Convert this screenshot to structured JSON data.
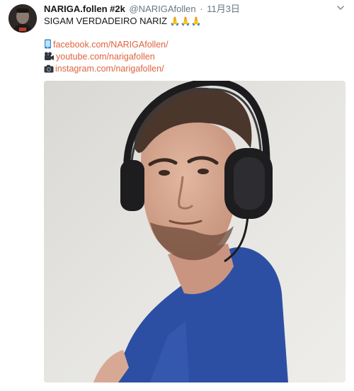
{
  "tweet": {
    "display_name": "NARIGA.follen #2k",
    "screen_name": "@NARIGAfollen",
    "separator": "·",
    "timestamp": "11月3日",
    "text": "SIGAM VERDADEIRO NARIZ",
    "text_emoji": "🙏🙏🙏",
    "links": [
      {
        "icon": "phone-icon",
        "text": "facebook.com/NARIGAfollen/"
      },
      {
        "icon": "video-camera-icon",
        "text": "youtube.com/narigafollen"
      },
      {
        "icon": "camera-icon",
        "text": "instagram.com/narigafollen/"
      }
    ],
    "media": {
      "kind": "photo"
    }
  },
  "colors": {
    "link": "#e0633e",
    "muted": "#657786",
    "text": "#14171a",
    "background": "#ffffff"
  }
}
